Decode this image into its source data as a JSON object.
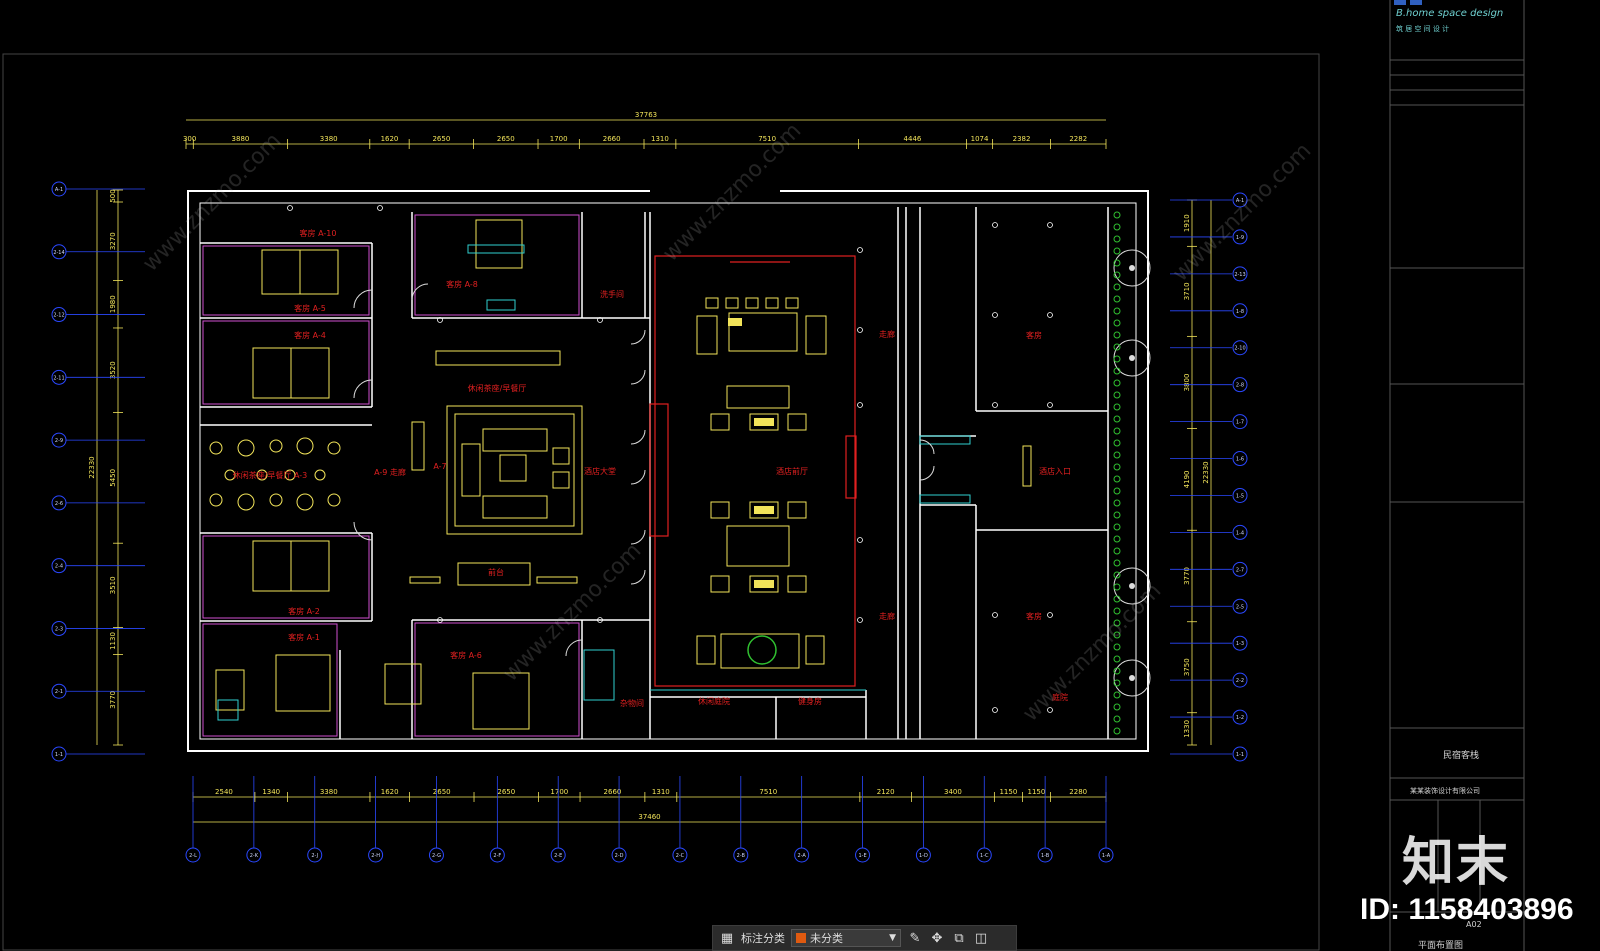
{
  "colors": {
    "background": "#000000",
    "wall": "#ffffff",
    "furniture": "#f2e45a",
    "dimension": "#f2e45a",
    "label_red": "#e02020",
    "axis_blue": "#2a48ff",
    "cyan": "#2fd0d0",
    "magenta": "#d050d0",
    "green": "#30c030",
    "category_swatch": "#e05a10"
  },
  "dimensions": {
    "top_total": "37763",
    "top_segments": [
      "300",
      "3880",
      "3380",
      "1620",
      "2650",
      "2650",
      "1700",
      "2660",
      "1310",
      "7510",
      "4446",
      "1074",
      "2382",
      "2282"
    ],
    "bottom_total": "37460",
    "bottom_segments": [
      "2540",
      "1340",
      "3380",
      "1620",
      "2650",
      "2650",
      "1700",
      "2660",
      "1310",
      "7510",
      "2120",
      "3400",
      "1150",
      "1150",
      "2280"
    ],
    "left_total": "22330",
    "left_segments": [
      "500",
      "3270",
      "1980",
      "3520",
      "5450",
      "3510",
      "1130",
      "3770"
    ],
    "right_total": "22330",
    "right_segments": [
      "1910",
      "3710",
      "3800",
      "4190",
      "3770",
      "3750",
      "1330"
    ]
  },
  "axes": {
    "left": [
      "A-1",
      "2-14",
      "2-12",
      "2-11",
      "2-9",
      "2-6",
      "2-4",
      "2-3",
      "2-1",
      "1-1"
    ],
    "right": [
      "A-1",
      "1-9",
      "2-13",
      "1-8",
      "2-10",
      "2-8",
      "1-7",
      "1-6",
      "1-5",
      "1-4",
      "2-7",
      "2-5",
      "1-3",
      "2-2",
      "1-2",
      "1-1"
    ],
    "bottom": [
      "2-L",
      "2-K",
      "2-J",
      "2-H",
      "2-G",
      "2-F",
      "2-E",
      "2-D",
      "2-C",
      "2-B",
      "2-A",
      "1-E",
      "1-D",
      "1-C",
      "1-B",
      "1-A"
    ]
  },
  "rooms": {
    "r_a10": "客房 A-10",
    "r_a5": "客房 A-5",
    "r_a4": "客房 A-4",
    "r_a3": "休闲茶座/早餐厅 A-3",
    "r_a2": "客房 A-2",
    "r_a1": "客房 A-1",
    "r_a8": "客房 A-8",
    "r_wash": "洗手间",
    "r_a7": "A-7",
    "r_a9": "A-9 走廊",
    "r_tea": "休闲茶座/早餐厅",
    "r_lobby": "酒店大堂",
    "r_reception": "前台",
    "r_a6": "客房 A-6",
    "r_yard": "休闲庭院",
    "r_hall": "酒店前厅",
    "r_store": "杂物间",
    "r_gym": "健身房",
    "r_entry": "酒店入口",
    "r_corr1": "走廊",
    "r_corr2": "走廊",
    "r_room_a": "客房",
    "r_room_b": "客房",
    "r_yard2": "庭院"
  },
  "watermark_site": "www.znzmo.com",
  "title_block": {
    "logo": "B.home space design",
    "logo_sub": "筑 居 空 间 设 计",
    "project": "民宿客栈",
    "company": "某某装饰设计有限公司",
    "drawing_name": "平面布置图",
    "drawing_no": "A02"
  },
  "toolbar": {
    "label": "标注分类",
    "selected": "未分类"
  },
  "watermark": {
    "logo_text": "知末",
    "id_text": "ID: 1158403896"
  }
}
